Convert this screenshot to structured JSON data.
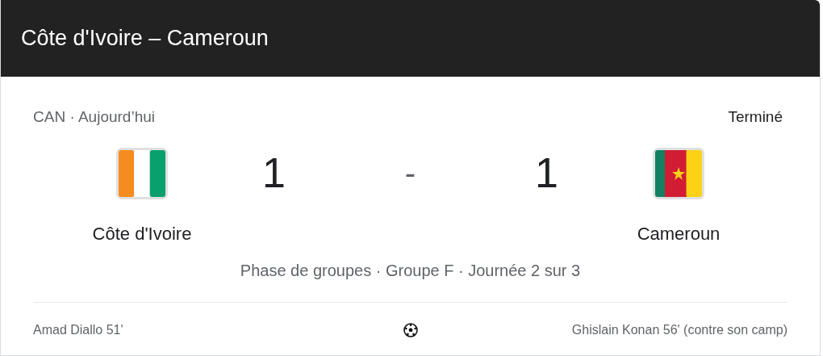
{
  "header": {
    "title": "Côte d'Ivoire – Cameroun"
  },
  "meta": {
    "competition_date": "CAN · Aujourd’hui",
    "status": "Terminé"
  },
  "teams": [
    {
      "name": "Côte d'Ivoire",
      "score": "1"
    },
    {
      "name": "Cameroun",
      "score": "1"
    }
  ],
  "separator": "-",
  "stage": "Phase de groupes · Groupe F · Journée 2 sur 3",
  "scorers": {
    "home": "Amad Diallo 51'",
    "away": "Ghislain Konan 56' (contre son camp)"
  }
}
